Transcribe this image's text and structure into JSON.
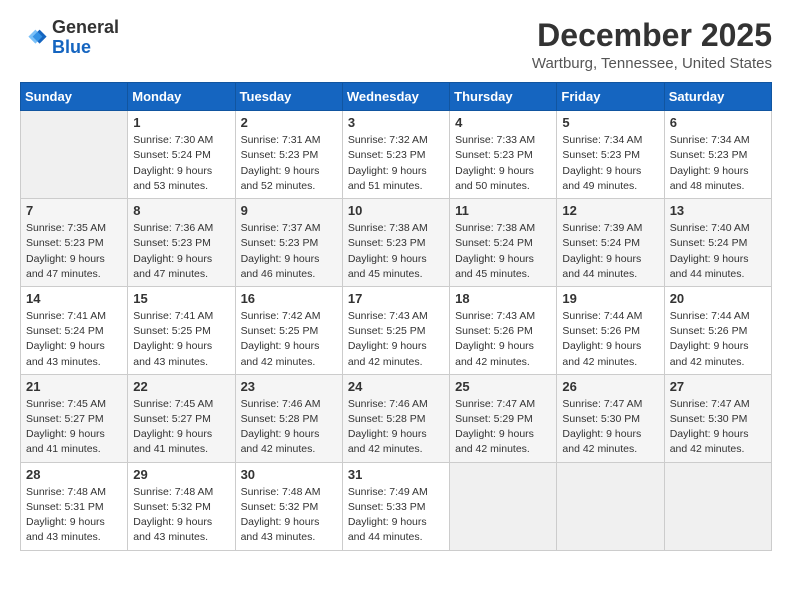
{
  "header": {
    "logo_general": "General",
    "logo_blue": "Blue",
    "month_title": "December 2025",
    "location": "Wartburg, Tennessee, United States"
  },
  "days_of_week": [
    "Sunday",
    "Monday",
    "Tuesday",
    "Wednesday",
    "Thursday",
    "Friday",
    "Saturday"
  ],
  "weeks": [
    [
      {
        "day": "",
        "info": ""
      },
      {
        "day": "1",
        "info": "Sunrise: 7:30 AM\nSunset: 5:24 PM\nDaylight: 9 hours\nand 53 minutes."
      },
      {
        "day": "2",
        "info": "Sunrise: 7:31 AM\nSunset: 5:23 PM\nDaylight: 9 hours\nand 52 minutes."
      },
      {
        "day": "3",
        "info": "Sunrise: 7:32 AM\nSunset: 5:23 PM\nDaylight: 9 hours\nand 51 minutes."
      },
      {
        "day": "4",
        "info": "Sunrise: 7:33 AM\nSunset: 5:23 PM\nDaylight: 9 hours\nand 50 minutes."
      },
      {
        "day": "5",
        "info": "Sunrise: 7:34 AM\nSunset: 5:23 PM\nDaylight: 9 hours\nand 49 minutes."
      },
      {
        "day": "6",
        "info": "Sunrise: 7:34 AM\nSunset: 5:23 PM\nDaylight: 9 hours\nand 48 minutes."
      }
    ],
    [
      {
        "day": "7",
        "info": "Sunrise: 7:35 AM\nSunset: 5:23 PM\nDaylight: 9 hours\nand 47 minutes."
      },
      {
        "day": "8",
        "info": "Sunrise: 7:36 AM\nSunset: 5:23 PM\nDaylight: 9 hours\nand 47 minutes."
      },
      {
        "day": "9",
        "info": "Sunrise: 7:37 AM\nSunset: 5:23 PM\nDaylight: 9 hours\nand 46 minutes."
      },
      {
        "day": "10",
        "info": "Sunrise: 7:38 AM\nSunset: 5:23 PM\nDaylight: 9 hours\nand 45 minutes."
      },
      {
        "day": "11",
        "info": "Sunrise: 7:38 AM\nSunset: 5:24 PM\nDaylight: 9 hours\nand 45 minutes."
      },
      {
        "day": "12",
        "info": "Sunrise: 7:39 AM\nSunset: 5:24 PM\nDaylight: 9 hours\nand 44 minutes."
      },
      {
        "day": "13",
        "info": "Sunrise: 7:40 AM\nSunset: 5:24 PM\nDaylight: 9 hours\nand 44 minutes."
      }
    ],
    [
      {
        "day": "14",
        "info": "Sunrise: 7:41 AM\nSunset: 5:24 PM\nDaylight: 9 hours\nand 43 minutes."
      },
      {
        "day": "15",
        "info": "Sunrise: 7:41 AM\nSunset: 5:25 PM\nDaylight: 9 hours\nand 43 minutes."
      },
      {
        "day": "16",
        "info": "Sunrise: 7:42 AM\nSunset: 5:25 PM\nDaylight: 9 hours\nand 42 minutes."
      },
      {
        "day": "17",
        "info": "Sunrise: 7:43 AM\nSunset: 5:25 PM\nDaylight: 9 hours\nand 42 minutes."
      },
      {
        "day": "18",
        "info": "Sunrise: 7:43 AM\nSunset: 5:26 PM\nDaylight: 9 hours\nand 42 minutes."
      },
      {
        "day": "19",
        "info": "Sunrise: 7:44 AM\nSunset: 5:26 PM\nDaylight: 9 hours\nand 42 minutes."
      },
      {
        "day": "20",
        "info": "Sunrise: 7:44 AM\nSunset: 5:26 PM\nDaylight: 9 hours\nand 42 minutes."
      }
    ],
    [
      {
        "day": "21",
        "info": "Sunrise: 7:45 AM\nSunset: 5:27 PM\nDaylight: 9 hours\nand 41 minutes."
      },
      {
        "day": "22",
        "info": "Sunrise: 7:45 AM\nSunset: 5:27 PM\nDaylight: 9 hours\nand 41 minutes."
      },
      {
        "day": "23",
        "info": "Sunrise: 7:46 AM\nSunset: 5:28 PM\nDaylight: 9 hours\nand 42 minutes."
      },
      {
        "day": "24",
        "info": "Sunrise: 7:46 AM\nSunset: 5:28 PM\nDaylight: 9 hours\nand 42 minutes."
      },
      {
        "day": "25",
        "info": "Sunrise: 7:47 AM\nSunset: 5:29 PM\nDaylight: 9 hours\nand 42 minutes."
      },
      {
        "day": "26",
        "info": "Sunrise: 7:47 AM\nSunset: 5:30 PM\nDaylight: 9 hours\nand 42 minutes."
      },
      {
        "day": "27",
        "info": "Sunrise: 7:47 AM\nSunset: 5:30 PM\nDaylight: 9 hours\nand 42 minutes."
      }
    ],
    [
      {
        "day": "28",
        "info": "Sunrise: 7:48 AM\nSunset: 5:31 PM\nDaylight: 9 hours\nand 43 minutes."
      },
      {
        "day": "29",
        "info": "Sunrise: 7:48 AM\nSunset: 5:32 PM\nDaylight: 9 hours\nand 43 minutes."
      },
      {
        "day": "30",
        "info": "Sunrise: 7:48 AM\nSunset: 5:32 PM\nDaylight: 9 hours\nand 43 minutes."
      },
      {
        "day": "31",
        "info": "Sunrise: 7:49 AM\nSunset: 5:33 PM\nDaylight: 9 hours\nand 44 minutes."
      },
      {
        "day": "",
        "info": ""
      },
      {
        "day": "",
        "info": ""
      },
      {
        "day": "",
        "info": ""
      }
    ]
  ]
}
